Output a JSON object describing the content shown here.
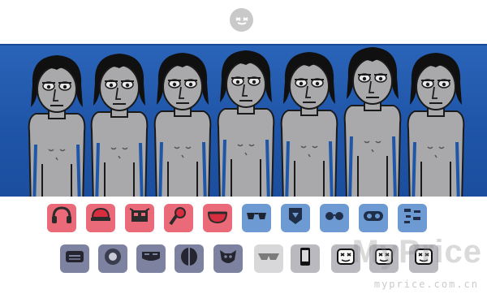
{
  "watermark": {
    "brand": "MyPrice",
    "url": "myprice.com.cn"
  },
  "colors": {
    "stage_blue": "#1f55a8",
    "beat_red": "#ea6a7a",
    "effect_blue": "#6d9ad3",
    "melody_slate": "#7d82a0",
    "voice_grey": "#b9b9bf",
    "character_body": "#a9a9ac"
  },
  "characters_count": 7,
  "palette": {
    "row1": [
      {
        "icon": "headphones-icon",
        "type": "beat"
      },
      {
        "icon": "cap-icon",
        "type": "beat"
      },
      {
        "icon": "robot-face-icon",
        "type": "beat"
      },
      {
        "icon": "microphone-icon",
        "type": "beat"
      },
      {
        "icon": "bowl-icon",
        "type": "beat"
      },
      {
        "icon": "sunglasses-icon",
        "type": "effect"
      },
      {
        "icon": "badge-icon",
        "type": "effect"
      },
      {
        "icon": "glasses-icon",
        "type": "effect"
      },
      {
        "icon": "mask-icon",
        "type": "effect"
      },
      {
        "icon": "pattern-icon",
        "type": "effect"
      }
    ],
    "row2": [
      {
        "icon": "robot-jaw-icon",
        "type": "melody"
      },
      {
        "icon": "visor-icon",
        "type": "melody"
      },
      {
        "icon": "goggles-icon",
        "type": "melody"
      },
      {
        "icon": "split-helmet-icon",
        "type": "melody"
      },
      {
        "icon": "winged-helmet-icon",
        "type": "melody"
      },
      {
        "icon": "shades-icon",
        "type": "voice"
      },
      {
        "icon": "phone-icon",
        "type": "voice"
      },
      {
        "icon": "marshmello-icon",
        "type": "voice"
      },
      {
        "icon": "marshmello-icon",
        "type": "voice"
      },
      {
        "icon": "marshmello-icon",
        "type": "voice"
      }
    ]
  }
}
